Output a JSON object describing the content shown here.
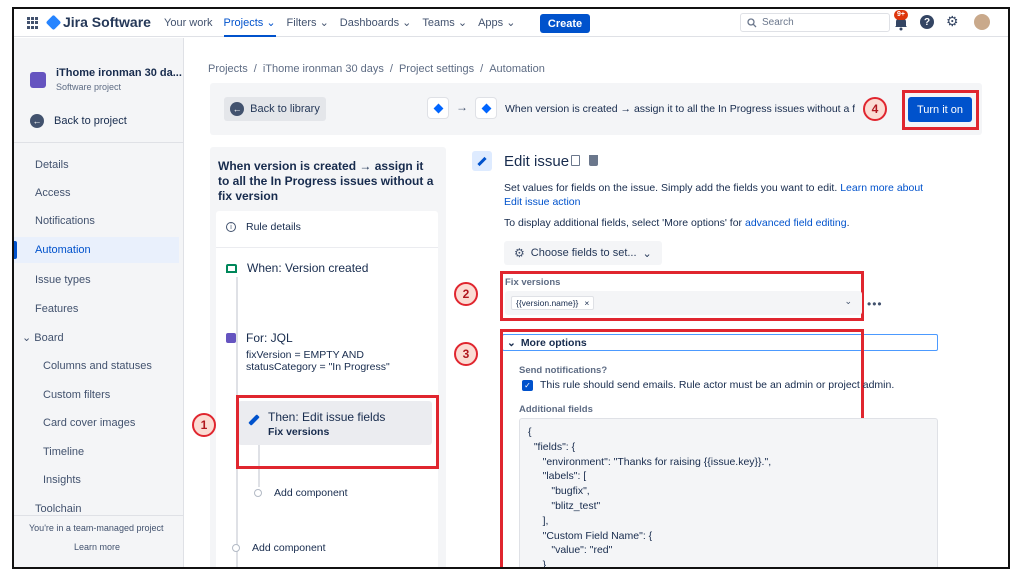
{
  "topnav": {
    "product": "Jira Software",
    "items": [
      {
        "label": "Your work",
        "active": false
      },
      {
        "label": "Projects",
        "active": true
      },
      {
        "label": "Filters",
        "active": false
      },
      {
        "label": "Dashboards",
        "active": false
      },
      {
        "label": "Teams",
        "active": false
      },
      {
        "label": "Apps",
        "active": false
      }
    ],
    "create_label": "Create",
    "search_placeholder": "Search",
    "notification_badge": "9+"
  },
  "sidebar": {
    "project_name": "iThome ironman 30 da...",
    "project_type": "Software project",
    "back_label": "Back to project",
    "items": [
      {
        "label": "Details"
      },
      {
        "label": "Access"
      },
      {
        "label": "Notifications"
      },
      {
        "label": "Automation"
      },
      {
        "label": "Issue types"
      },
      {
        "label": "Features"
      },
      {
        "label": "Board"
      },
      {
        "label": "Columns and statuses"
      },
      {
        "label": "Custom filters"
      },
      {
        "label": "Card cover images"
      },
      {
        "label": "Timeline"
      },
      {
        "label": "Insights"
      },
      {
        "label": "Toolchain"
      }
    ],
    "footer_text": "You're in a team-managed project",
    "footer_link": "Learn more"
  },
  "breadcrumb": {
    "items": [
      "Projects",
      "iThome ironman 30 days",
      "Project settings",
      "Automation"
    ],
    "separator": "/"
  },
  "rule_bar": {
    "back_library_label": "Back to library",
    "description": "When version is created → assign it to all the In Progress issues without a fix",
    "turn_on_label": "Turn it on"
  },
  "rule": {
    "title": "When version is created → assign it to all the In Progress issues without a fix version",
    "details_label": "Rule details",
    "trigger": "When: Version created",
    "branch": "For: JQL",
    "jql_line1": "fixVersion = EMPTY AND",
    "jql_line2": "statusCategory = \"In Progress\"",
    "action_title": "Then: Edit issue fields",
    "action_sub": "Fix versions",
    "add_component_inner": "Add component",
    "add_component_outer": "Add component"
  },
  "edit_panel": {
    "title": "Edit issue",
    "description": "Set values for fields on the issue. Simply add the fields you want to edit.",
    "learn_more": "Learn more about Edit issue action",
    "advanced_prefix": "To display additional fields, select 'More options' for",
    "advanced_link": "advanced field editing",
    "advanced_suffix": ".",
    "choose_fields_label": "Choose fields to set...",
    "fix_versions_label": "Fix versions",
    "fix_versions_chip": "{{version.name}}",
    "more_options_label": "More options",
    "send_notifications_label": "Send notifications?",
    "send_email_text": "This rule should send emails. Rule actor must be an admin or project admin.",
    "additional_fields_label": "Additional fields",
    "additional_fields_code": "{\n  \"fields\": {\n     \"environment\": \"Thanks for raising {{issue.key}}.\",\n     \"labels\": [\n        \"bugfix\",\n        \"blitz_test\"\n     ],\n     \"Custom Field Name\": {\n        \"value\": \"red\"\n     }\n  }\n}"
  },
  "annotations": [
    "1",
    "2",
    "3",
    "4"
  ],
  "colors": {
    "brand_blue": "#0052cc",
    "annotation_red": "#e0262f",
    "annotation_fill": "#fbdcd4"
  }
}
